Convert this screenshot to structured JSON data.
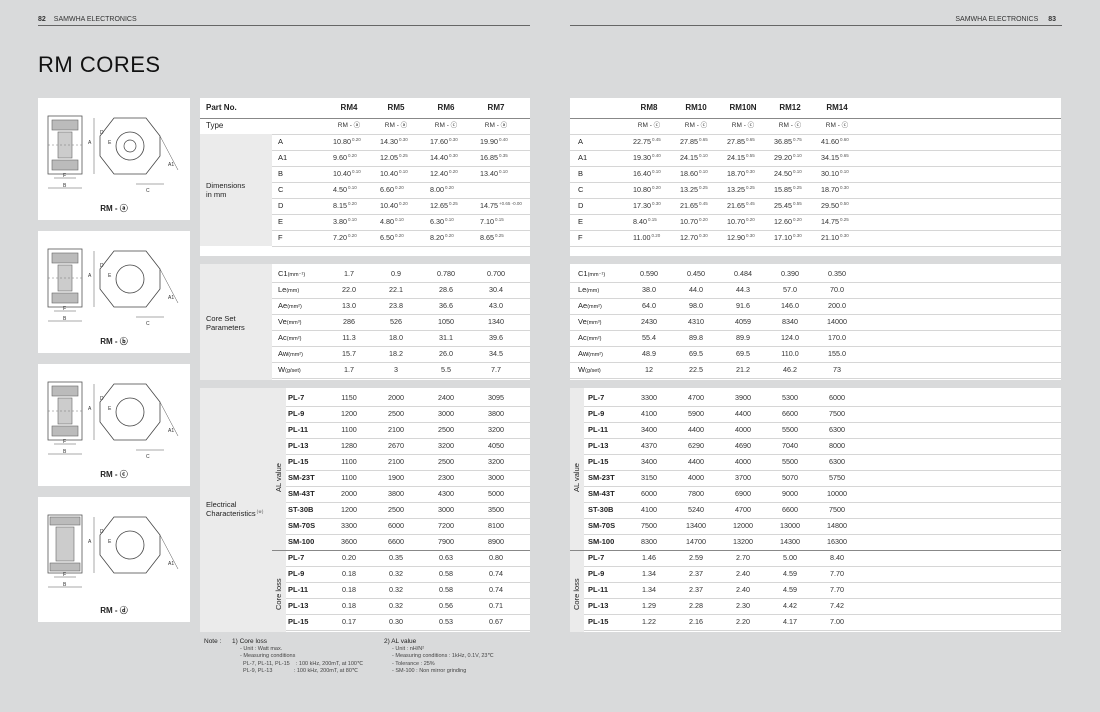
{
  "header": {
    "left_page": "82",
    "left_brand": "SAMWHA ELECTRONICS",
    "right_brand": "SAMWHA ELECTRONICS",
    "right_page": "83"
  },
  "title": "RM CORES",
  "figures": [
    {
      "caption": "RM - ⓐ"
    },
    {
      "caption": "RM - ⓑ"
    },
    {
      "caption": "RM - ⓒ"
    },
    {
      "caption": "RM - ⓓ"
    }
  ],
  "left_table": {
    "part_no_label": "Part No.",
    "type_label": "Type",
    "parts": [
      "RM4",
      "RM5",
      "RM6",
      "RM7"
    ],
    "types": [
      "RM - ⓐ",
      "RM - ⓐ",
      "RM - ⓒ",
      "RM - ⓐ"
    ],
    "dims_label": "Dimensions\nin mm",
    "dims": [
      {
        "k": "A",
        "v": [
          [
            "10.80",
            "0.20"
          ],
          [
            "14.30",
            "0.30"
          ],
          [
            "17.60",
            "0.30"
          ],
          [
            "19.90",
            "0.40"
          ]
        ]
      },
      {
        "k": "A1",
        "v": [
          [
            "9.60",
            "0.20"
          ],
          [
            "12.05",
            "0.25"
          ],
          [
            "14.40",
            "0.30"
          ],
          [
            "16.85",
            "0.35"
          ]
        ]
      },
      {
        "k": "B",
        "v": [
          [
            "10.40",
            "0.10"
          ],
          [
            "10.40",
            "0.10"
          ],
          [
            "12.40",
            "0.20"
          ],
          [
            "13.40",
            "0.10"
          ]
        ]
      },
      {
        "k": "C",
        "v": [
          [
            "4.50",
            "0.10"
          ],
          [
            "6.60",
            "0.20"
          ],
          [
            "8.00",
            "0.20"
          ],
          [
            "",
            ""
          ]
        ]
      },
      {
        "k": "D",
        "v": [
          [
            "8.15",
            "0.20"
          ],
          [
            "10.40",
            "0.20"
          ],
          [
            "12.65",
            "0.25"
          ],
          [
            "14.75",
            "+0.65 -0.00"
          ]
        ]
      },
      {
        "k": "E",
        "v": [
          [
            "3.80",
            "0.10"
          ],
          [
            "4.80",
            "0.10"
          ],
          [
            "6.30",
            "0.10"
          ],
          [
            "7.10",
            "0.15"
          ]
        ]
      },
      {
        "k": "F",
        "v": [
          [
            "7.20",
            "0.20"
          ],
          [
            "6.50",
            "0.20"
          ],
          [
            "8.20",
            "0.20"
          ],
          [
            "8.65",
            "0.25"
          ]
        ]
      }
    ],
    "core_label": "Core Set\nParameters",
    "core": [
      {
        "k": "C1",
        "u": "(mm⁻¹)",
        "v": [
          "1.7",
          "0.9",
          "0.780",
          "0.700"
        ]
      },
      {
        "k": "Le",
        "u": "(mm)",
        "v": [
          "22.0",
          "22.1",
          "28.6",
          "30.4"
        ]
      },
      {
        "k": "Ae",
        "u": "(mm²)",
        "v": [
          "13.0",
          "23.8",
          "36.6",
          "43.0"
        ]
      },
      {
        "k": "Ve",
        "u": "(mm³)",
        "v": [
          "286",
          "526",
          "1050",
          "1340"
        ]
      },
      {
        "k": "Ac",
        "u": "(mm²)",
        "v": [
          "11.3",
          "18.0",
          "31.1",
          "39.6"
        ]
      },
      {
        "k": "Aw",
        "u": "(mm²)",
        "v": [
          "15.7",
          "18.2",
          "26.0",
          "34.5"
        ]
      },
      {
        "k": "W",
        "u": "(g/set)",
        "v": [
          "1.7",
          "3",
          "5.5",
          "7.7"
        ]
      }
    ],
    "elec_label": "Electrical\nCharacteristics",
    "elec_sub": "(※)",
    "al_label": "AL value",
    "al": [
      {
        "k": "PL-7",
        "v": [
          "1150",
          "2000",
          "2400",
          "3095"
        ]
      },
      {
        "k": "PL-9",
        "v": [
          "1200",
          "2500",
          "3000",
          "3800"
        ]
      },
      {
        "k": "PL-11",
        "v": [
          "1100",
          "2100",
          "2500",
          "3200"
        ]
      },
      {
        "k": "PL-13",
        "v": [
          "1280",
          "2670",
          "3200",
          "4050"
        ]
      },
      {
        "k": "PL-15",
        "v": [
          "1100",
          "2100",
          "2500",
          "3200"
        ]
      },
      {
        "k": "SM-23T",
        "v": [
          "1100",
          "1900",
          "2300",
          "3000"
        ]
      },
      {
        "k": "SM-43T",
        "v": [
          "2000",
          "3800",
          "4300",
          "5000"
        ]
      },
      {
        "k": "ST-30B",
        "v": [
          "1200",
          "2500",
          "3000",
          "3500"
        ]
      },
      {
        "k": "SM-70S",
        "v": [
          "3300",
          "6000",
          "7200",
          "8100"
        ]
      },
      {
        "k": "SM-100",
        "v": [
          "3600",
          "6600",
          "7900",
          "8900"
        ]
      }
    ],
    "loss_label": "Core loss",
    "loss": [
      {
        "k": "PL-7",
        "v": [
          "0.20",
          "0.35",
          "0.63",
          "0.80"
        ]
      },
      {
        "k": "PL-9",
        "v": [
          "0.18",
          "0.32",
          "0.58",
          "0.74"
        ]
      },
      {
        "k": "PL-11",
        "v": [
          "0.18",
          "0.32",
          "0.58",
          "0.74"
        ]
      },
      {
        "k": "PL-13",
        "v": [
          "0.18",
          "0.32",
          "0.56",
          "0.71"
        ]
      },
      {
        "k": "PL-15",
        "v": [
          "0.17",
          "0.30",
          "0.53",
          "0.67"
        ]
      }
    ]
  },
  "right_table": {
    "parts": [
      "RM8",
      "RM10",
      "RM10N",
      "RM12",
      "RM14"
    ],
    "types": [
      "RM - ⓒ",
      "RM - ⓒ",
      "RM - ⓒ",
      "RM - ⓒ",
      "RM - ⓒ"
    ],
    "dims": [
      {
        "k": "A",
        "v": [
          [
            "22.75",
            "0.45"
          ],
          [
            "27.85",
            "0.65"
          ],
          [
            "27.85",
            "0.65"
          ],
          [
            "36.85",
            "0.75"
          ],
          [
            "41.60",
            "0.60"
          ]
        ]
      },
      {
        "k": "A1",
        "v": [
          [
            "19.30",
            "0.40"
          ],
          [
            "24.15",
            "0.10"
          ],
          [
            "24.15",
            "0.55"
          ],
          [
            "29.20",
            "0.10"
          ],
          [
            "34.15",
            "0.65"
          ]
        ]
      },
      {
        "k": "B",
        "v": [
          [
            "16.40",
            "0.10"
          ],
          [
            "18.60",
            "0.10"
          ],
          [
            "18.70",
            "0.30"
          ],
          [
            "24.50",
            "0.10"
          ],
          [
            "30.10",
            "0.10"
          ]
        ]
      },
      {
        "k": "C",
        "v": [
          [
            "10.80",
            "0.20"
          ],
          [
            "13.25",
            "0.25"
          ],
          [
            "13.25",
            "0.25"
          ],
          [
            "15.85",
            "0.25"
          ],
          [
            "18.70",
            "0.30"
          ]
        ]
      },
      {
        "k": "D",
        "v": [
          [
            "17.30",
            "0.30"
          ],
          [
            "21.65",
            "0.45"
          ],
          [
            "21.65",
            "0.45"
          ],
          [
            "25.45",
            "0.55"
          ],
          [
            "29.50",
            "0.50"
          ]
        ]
      },
      {
        "k": "E",
        "v": [
          [
            "8.40",
            "0.15"
          ],
          [
            "10.70",
            "0.20"
          ],
          [
            "10.70",
            "0.20"
          ],
          [
            "12.60",
            "0.20"
          ],
          [
            "14.75",
            "0.25"
          ]
        ]
      },
      {
        "k": "F",
        "v": [
          [
            "11.00",
            "0.20"
          ],
          [
            "12.70",
            "0.30"
          ],
          [
            "12.90",
            "0.30"
          ],
          [
            "17.10",
            "0.30"
          ],
          [
            "21.10",
            "0.30"
          ]
        ]
      }
    ],
    "core": [
      {
        "k": "C1",
        "u": "(mm⁻¹)",
        "v": [
          "0.590",
          "0.450",
          "0.484",
          "0.390",
          "0.350"
        ]
      },
      {
        "k": "Le",
        "u": "(mm)",
        "v": [
          "38.0",
          "44.0",
          "44.3",
          "57.0",
          "70.0"
        ]
      },
      {
        "k": "Ae",
        "u": "(mm²)",
        "v": [
          "64.0",
          "98.0",
          "91.6",
          "146.0",
          "200.0"
        ]
      },
      {
        "k": "Ve",
        "u": "(mm³)",
        "v": [
          "2430",
          "4310",
          "4059",
          "8340",
          "14000"
        ]
      },
      {
        "k": "Ac",
        "u": "(mm²)",
        "v": [
          "55.4",
          "89.8",
          "89.9",
          "124.0",
          "170.0"
        ]
      },
      {
        "k": "Aw",
        "u": "(mm²)",
        "v": [
          "48.9",
          "69.5",
          "69.5",
          "110.0",
          "155.0"
        ]
      },
      {
        "k": "W",
        "u": "(g/set)",
        "v": [
          "12",
          "22.5",
          "21.2",
          "46.2",
          "73"
        ]
      }
    ],
    "al_label": "AL value",
    "al": [
      {
        "k": "PL-7",
        "v": [
          "3300",
          "4700",
          "3900",
          "5300",
          "6000"
        ]
      },
      {
        "k": "PL-9",
        "v": [
          "4100",
          "5900",
          "4400",
          "6600",
          "7500"
        ]
      },
      {
        "k": "PL-11",
        "v": [
          "3400",
          "4400",
          "4000",
          "5500",
          "6300"
        ]
      },
      {
        "k": "PL-13",
        "v": [
          "4370",
          "6290",
          "4690",
          "7040",
          "8000"
        ]
      },
      {
        "k": "PL-15",
        "v": [
          "3400",
          "4400",
          "4000",
          "5500",
          "6300"
        ]
      },
      {
        "k": "SM-23T",
        "v": [
          "3150",
          "4000",
          "3700",
          "5070",
          "5750"
        ]
      },
      {
        "k": "SM-43T",
        "v": [
          "6000",
          "7800",
          "6900",
          "9000",
          "10000"
        ]
      },
      {
        "k": "ST-30B",
        "v": [
          "4100",
          "5240",
          "4700",
          "6600",
          "7500"
        ]
      },
      {
        "k": "SM-70S",
        "v": [
          "7500",
          "13400",
          "12000",
          "13000",
          "14800"
        ]
      },
      {
        "k": "SM-100",
        "v": [
          "8300",
          "14700",
          "13200",
          "14300",
          "16300"
        ]
      }
    ],
    "loss_label": "Core loss",
    "loss": [
      {
        "k": "PL-7",
        "v": [
          "1.46",
          "2.59",
          "2.70",
          "5.00",
          "8.40"
        ]
      },
      {
        "k": "PL-9",
        "v": [
          "1.34",
          "2.37",
          "2.40",
          "4.59",
          "7.70"
        ]
      },
      {
        "k": "PL-11",
        "v": [
          "1.34",
          "2.37",
          "2.40",
          "4.59",
          "7.70"
        ]
      },
      {
        "k": "PL-13",
        "v": [
          "1.29",
          "2.28",
          "2.30",
          "4.42",
          "7.42"
        ]
      },
      {
        "k": "PL-15",
        "v": [
          "1.22",
          "2.16",
          "2.20",
          "4.17",
          "7.00"
        ]
      }
    ]
  },
  "notes": {
    "label": "Note :",
    "n1_title": "1) Core loss",
    "n1_lines": [
      "- Unit : Watt max.",
      "- Measuring conditions",
      "  PL-7, PL-11, PL-15    : 100 kHz, 200mT, at 100℃",
      "  PL-9, PL-13              : 100 kHz, 200mT, at 80℃"
    ],
    "n2_title": "2) AL value",
    "n2_lines": [
      "- Unit : nH/N²",
      "- Measuring conditions : 1kHz, 0.1V, 23℃",
      "- Tolerance :   25%",
      "- SM-100 : Non mirror grinding"
    ]
  },
  "colors": {
    "page_bg": "#d9dadb",
    "panel_bg": "#ffffff",
    "label_col_bg": "#ebebeb"
  }
}
